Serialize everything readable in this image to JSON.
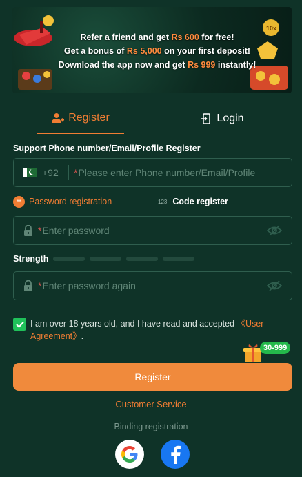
{
  "banner": {
    "line1_pre": "Refer a friend and get ",
    "line1_hl": "Rs 600",
    "line1_post": " for free!",
    "line2_pre": "Get a bonus of ",
    "line2_hl": "Rs 5,000",
    "line2_post": " on your first deposit!",
    "line3_pre": "Download the app now and get ",
    "line3_hl": "Rs 999",
    "line3_post": " instantly!"
  },
  "tabs": {
    "register": "Register",
    "login": "Login"
  },
  "phone_section": {
    "label": "Support Phone number/Email/Profile Register",
    "country_code": "+92",
    "placeholder": "Please enter Phone number/Email/Profile",
    "required_mark": "*"
  },
  "modes": {
    "password_icon_text": "**",
    "password": "Password registration",
    "code_icon_text": "123",
    "code": "Code register"
  },
  "password": {
    "placeholder": "Enter password",
    "required_mark": "*"
  },
  "strength": {
    "label": "Strength"
  },
  "password_again": {
    "placeholder": "Enter password again",
    "required_mark": "*"
  },
  "agreement": {
    "text": "I am over 18 years old, and I have read and accepted ",
    "link": "《User Agreement》",
    "tail": ".",
    "checked": true
  },
  "gift_badge": "30-999",
  "register_button": "Register",
  "customer_service": "Customer Service",
  "binding_label": "Binding registration",
  "colors": {
    "background": "#0f3328",
    "accent": "#f07d33",
    "check": "#20c15a",
    "facebook": "#1877f2"
  }
}
